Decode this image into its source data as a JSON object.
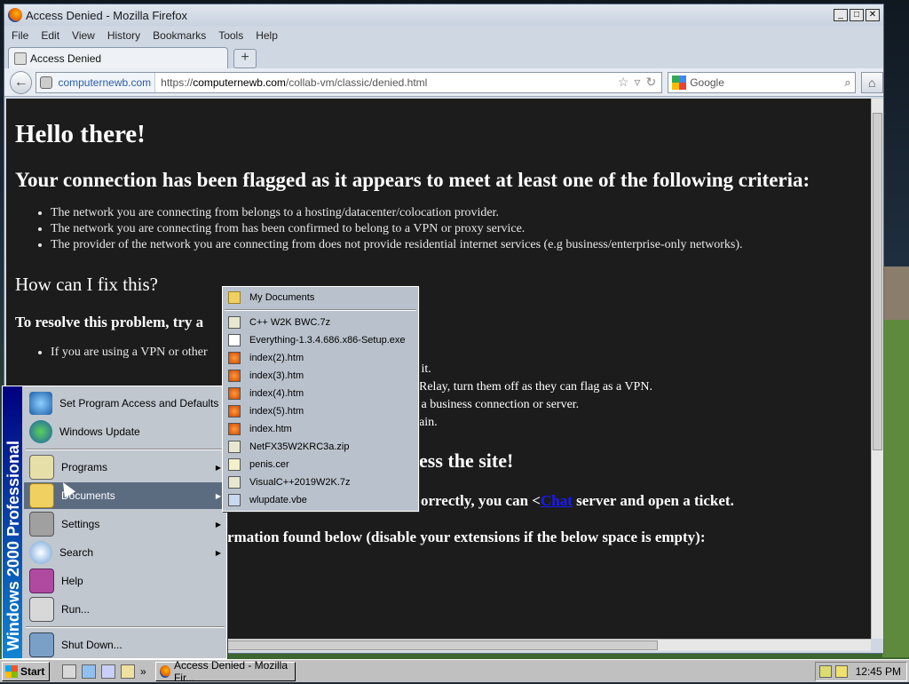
{
  "window": {
    "title": "Access Denied - Mozilla Firefox",
    "controls": {
      "minimize": "_",
      "maximize": "□",
      "close": "✕"
    }
  },
  "menubar": [
    "File",
    "Edit",
    "View",
    "History",
    "Bookmarks",
    "Tools",
    "Help"
  ],
  "tabs": [
    {
      "label": "Access Denied"
    }
  ],
  "new_tab_label": "+",
  "nav": {
    "identity": "computernewb.com",
    "url_prefix": "https://",
    "url_domain": "computernewb.com",
    "url_path": "/collab-vm/classic/denied.html",
    "search_placeholder": "Google"
  },
  "page": {
    "h1": "Hello there!",
    "h2": "Your connection has been flagged as it appears to meet at least one of the following criteria:",
    "criteria": [
      "The network you are connecting from belongs to a hosting/datacenter/colocation provider.",
      "The network you are connecting from has been confirmed to belong to a VPN or proxy service.",
      "The provider of the network you are connecting from does not provide residential internet services (e.g business/enterprise-only networks)."
    ],
    "fix_heading": "How can I fix this?",
    "resolve_heading": "To resolve this problem, try a",
    "fix_items": [
      "If you are using a VPN or other",
      "g it.",
      "Relay, turn them off as they can flag as a VPN.",
      "g a business connection or server.",
      "ain."
    ],
    "partial_heading_1": "ess the site!",
    "partial_line_2_pre": "orrectly, you can <",
    "partial_line_2_link": "Chat",
    "partial_line_2_post": " server and open a ticket.",
    "partial_line_3": "rmation found below (disable your extensions if the below space is empty):"
  },
  "start_menu": {
    "band_text": "Windows 2000 Professional",
    "items": [
      {
        "label": "Set Program Access and Defaults",
        "arrow": false
      },
      {
        "label": "Windows Update",
        "arrow": false
      },
      {
        "label": "Programs",
        "arrow": true
      },
      {
        "label": "Documents",
        "arrow": true
      },
      {
        "label": "Settings",
        "arrow": true
      },
      {
        "label": "Search",
        "arrow": true
      },
      {
        "label": "Help",
        "arrow": false
      },
      {
        "label": "Run...",
        "arrow": false
      },
      {
        "label": "Shut Down...",
        "arrow": false
      }
    ],
    "arrow_glyph": "▶"
  },
  "documents_menu": {
    "header": "My Documents",
    "files": [
      {
        "name": "C++ W2K BWC.7z",
        "icon": "archive-icon"
      },
      {
        "name": "Everything-1.3.4.686.x86-Setup.exe",
        "icon": "exe-icon"
      },
      {
        "name": "index(2).htm",
        "icon": "html-icon"
      },
      {
        "name": "index(3).htm",
        "icon": "html-icon"
      },
      {
        "name": "index(4).htm",
        "icon": "html-icon"
      },
      {
        "name": "index(5).htm",
        "icon": "html-icon"
      },
      {
        "name": "index.htm",
        "icon": "html-icon"
      },
      {
        "name": "NetFX35W2KRC3a.zip",
        "icon": "archive-icon"
      },
      {
        "name": "penis.cer",
        "icon": "certificate-icon"
      },
      {
        "name": "VisualC++2019W2K.7z",
        "icon": "archive-icon"
      },
      {
        "name": "wlupdate.vbe",
        "icon": "script-icon"
      }
    ]
  },
  "taskbar": {
    "start_label": "Start",
    "more_label": "»",
    "task_label": "Access Denied - Mozilla Fir...",
    "clock": "12:45 PM"
  },
  "colors": {
    "highlight": "#5b6b80",
    "link": "#1a1aff"
  }
}
